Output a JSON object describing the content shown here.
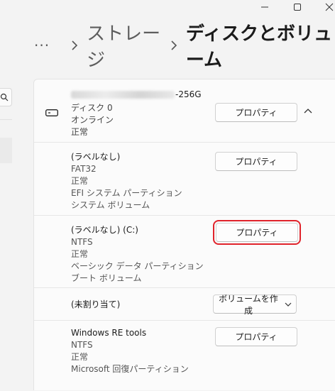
{
  "breadcrumb": {
    "more": "···",
    "parent": "ストレージ",
    "current": "ディスクとボリューム"
  },
  "disk": {
    "model_suffix": "-256G",
    "name": "ディスク 0",
    "state": "オンライン",
    "health": "正常",
    "properties_label": "プロパティ"
  },
  "partitions": [
    {
      "label": "(ラベルなし)",
      "lines": [
        "FAT32",
        "正常",
        "EFI システム パーティション",
        "システム ボリューム"
      ],
      "button": "プロパティ"
    },
    {
      "label": "(ラベルなし) (C:)",
      "lines": [
        "NTFS",
        "正常",
        "ベーシック データ パーティション",
        "ブート ボリューム"
      ],
      "button": "プロパティ"
    },
    {
      "label": "(未割り当て)",
      "lines": [],
      "button": "ボリュームを作成"
    },
    {
      "label": "Windows RE tools",
      "lines": [
        "NTFS",
        "正常",
        "Microsoft 回復パーティション"
      ],
      "button": "プロパティ"
    }
  ],
  "colors": {
    "highlight": "#e0232b",
    "background": "#f3f3f3",
    "card": "#fbfbfb"
  }
}
